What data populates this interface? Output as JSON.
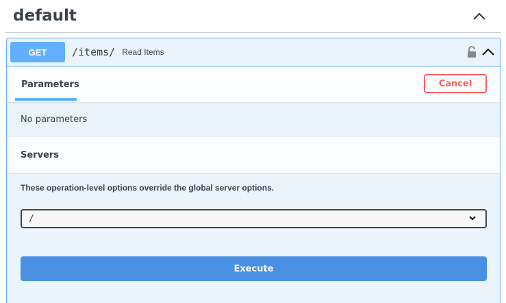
{
  "section": {
    "title": "default"
  },
  "operation": {
    "method": "GET",
    "path": "/items/",
    "summary": "Read Items"
  },
  "parameters": {
    "tab_label": "Parameters",
    "cancel_label": "Cancel",
    "empty_text": "No parameters"
  },
  "servers": {
    "title": "Servers",
    "note": "These operation-level options override the global server options.",
    "selected": "/"
  },
  "actions": {
    "execute_label": "Execute"
  },
  "colors": {
    "get_accent": "#61affe",
    "cancel_red": "#ff6060",
    "execute_blue": "#4990e2",
    "opblock_bg": "#ebf3fb"
  },
  "icons": [
    "chevron-up-icon",
    "lock-icon",
    "chevron-down-icon"
  ]
}
